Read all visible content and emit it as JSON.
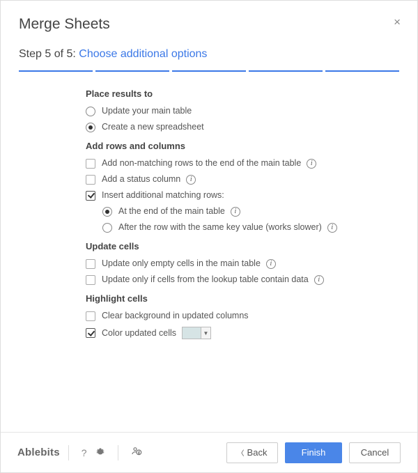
{
  "header": {
    "title": "Merge Sheets"
  },
  "step": {
    "label": "Step 5 of 5: ",
    "subtitle": "Choose additional options"
  },
  "sections": {
    "place": {
      "heading": "Place results to",
      "opt_update": "Update your main table",
      "opt_create": "Create a new spreadsheet"
    },
    "addrows": {
      "heading": "Add rows and columns",
      "nonmatching": "Add non-matching rows to the end of the main table",
      "status": "Add a status column",
      "insert": "Insert additional matching rows:",
      "insert_end": "At the end of the main table",
      "insert_key": "After the row with the same key value (works slower)"
    },
    "update": {
      "heading": "Update cells",
      "empty": "Update only empty cells in the main table",
      "contain": "Update only if cells from the lookup table contain data"
    },
    "highlight": {
      "heading": "Highlight cells",
      "clear": "Clear background in updated columns",
      "color": "Color updated cells",
      "swatch": "#d6e4e5"
    }
  },
  "footer": {
    "brand": "Ablebits",
    "back": "Back",
    "finish": "Finish",
    "cancel": "Cancel"
  }
}
